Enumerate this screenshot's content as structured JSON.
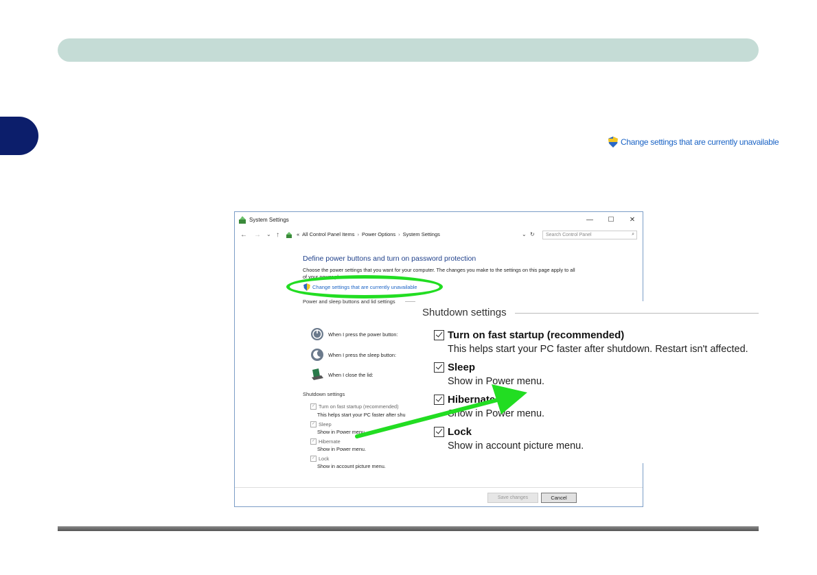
{
  "top_link": {
    "label": "Change settings that are currently unavailable"
  },
  "window": {
    "title": "System Settings",
    "controls": {
      "minimize": "—",
      "maximize": "☐",
      "close": "✕"
    },
    "nav": {
      "back": "←",
      "forward": "→",
      "recent": "⌄",
      "up": "↑",
      "overflow": "«",
      "breadcrumb": [
        "All Control Panel Items",
        "Power Options",
        "System Settings"
      ],
      "separator": "›",
      "dropdown": "⌄",
      "refresh": "↻",
      "search_placeholder": "Search Control Panel"
    },
    "heading": "Define power buttons and turn on password protection",
    "description": "Choose the power settings that you want for your computer. The changes you make to the settings on this page apply to all of your power plans.",
    "change_link": "Change settings that are currently unavailable",
    "power_sleep_label": "Power and sleep buttons and lid settings",
    "rows": [
      {
        "label": "When I press the power button:",
        "icon": "power-icon"
      },
      {
        "label": "When I press the sleep button:",
        "icon": "sleep-icon"
      },
      {
        "label": "When I close the lid:",
        "icon": "laptop-icon"
      }
    ],
    "shutdown_label": "Shutdown settings",
    "shutdown_items": [
      {
        "label": "Turn on fast startup (recommended)",
        "sub": "This helps start your PC faster after shu"
      },
      {
        "label": "Sleep",
        "sub": "Show in Power menu."
      },
      {
        "label": "Hibernate",
        "sub": "Show in Power menu."
      },
      {
        "label": "Lock",
        "sub": "Show in account picture menu."
      }
    ],
    "save_label": "Save changes",
    "cancel_label": "Cancel"
  },
  "zoom": {
    "title": "Shutdown settings",
    "items": [
      {
        "label": "Turn on fast startup (recommended)",
        "sub": "This helps start your PC faster after shutdown. Restart isn't affected.",
        "checked": true
      },
      {
        "label": "Sleep",
        "sub": "Show in Power menu.",
        "checked": true
      },
      {
        "label": "Hibernate",
        "sub": "Show in Power menu.",
        "checked": true
      },
      {
        "label": "Lock",
        "sub": "Show in account picture menu.",
        "checked": true
      }
    ]
  },
  "colors": {
    "header": "#c5dcd6",
    "tab": "#0c1e6b",
    "highlight": "#22dd22",
    "link": "#1a63c5"
  }
}
